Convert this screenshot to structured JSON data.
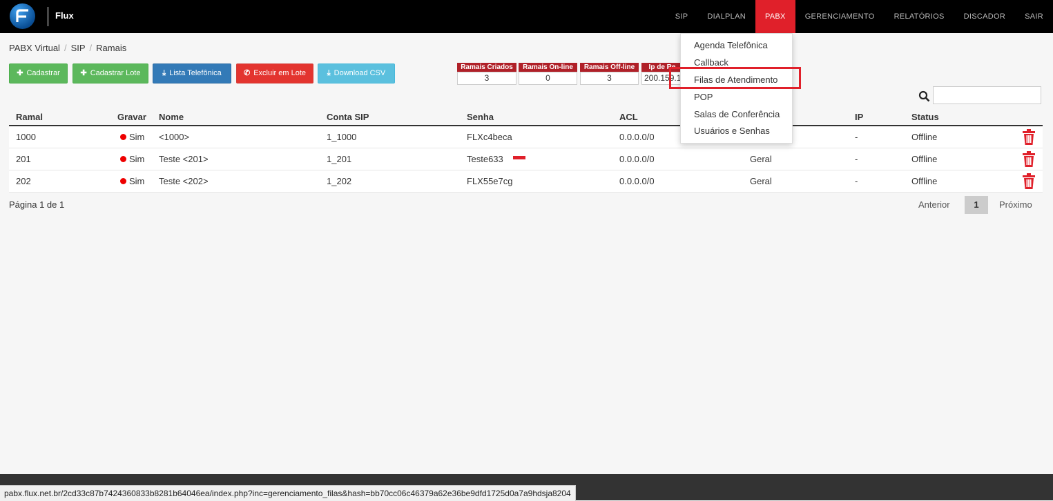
{
  "brand": {
    "name": "Flux"
  },
  "nav": [
    {
      "label": "SIP",
      "active": false
    },
    {
      "label": "DIALPLAN",
      "active": false
    },
    {
      "label": "PABX",
      "active": true
    },
    {
      "label": "GERENCIAMENTO",
      "active": false
    },
    {
      "label": "RELATÓRIOS",
      "active": false
    },
    {
      "label": "DISCADOR",
      "active": false
    },
    {
      "label": "SAIR",
      "active": false
    }
  ],
  "breadcrumb": [
    "PABX Virtual",
    "SIP",
    "Ramais"
  ],
  "breadcrumb_sep": "/",
  "buttons": {
    "cadastrar": "Cadastrar",
    "cadastrar_lote": "Cadastrar Lote",
    "lista_telefonica": "Lista Telefônica",
    "excluir_lote": "Excluir em Lote",
    "download_csv": "Download CSV"
  },
  "counters": [
    {
      "label": "Ramais Criados",
      "value": "3"
    },
    {
      "label": "Ramais On-line",
      "value": "0"
    },
    {
      "label": "Ramais Off-line",
      "value": "3"
    },
    {
      "label": "Ip de Re",
      "value": "200.159.1"
    }
  ],
  "search": {
    "placeholder": "",
    "value": ""
  },
  "table": {
    "headers": {
      "ramal": "Ramal",
      "gravar": "Gravar",
      "nome": "Nome",
      "conta": "Conta SIP",
      "senha": "Senha",
      "acl": "ACL",
      "ip": "IP",
      "status": "Status"
    },
    "rows": [
      {
        "ramal": "1000",
        "gravar": "Sim",
        "nome": "<1000>",
        "conta": "1_1000",
        "senha": "FLXc4beca",
        "acl": "0.0.0.0/0",
        "grupo": "",
        "ip": "-",
        "status": "Offline"
      },
      {
        "ramal": "201",
        "gravar": "Sim",
        "nome": "Teste <201>",
        "conta": "1_201",
        "senha": "Teste633",
        "acl": "0.0.0.0/0",
        "grupo": "Geral",
        "ip": "-",
        "status": "Offline"
      },
      {
        "ramal": "202",
        "gravar": "Sim",
        "nome": "Teste <202>",
        "conta": "1_202",
        "senha": "FLX55e7cg",
        "acl": "0.0.0.0/0",
        "grupo": "Geral",
        "ip": "-",
        "status": "Offline"
      }
    ]
  },
  "pagination": {
    "info": "Página 1 de 1",
    "prev": "Anterior",
    "current": "1",
    "next": "Próximo"
  },
  "dropdown": [
    "Agenda Telefônica",
    "Callback",
    "Filas de Atendimento",
    "POP",
    "Salas de Conferência",
    "Usuários e Senhas"
  ],
  "status_url": "pabx.flux.net.br/2cd33c87b7424360833b8281b64046ea/index.php?inc=gerenciamento_filas&hash=bb70cc06c46379a62e36be9dfd1725d0a7a9hdsja8204",
  "colors": {
    "accent": "#e0202a",
    "topbar": "#000000"
  }
}
